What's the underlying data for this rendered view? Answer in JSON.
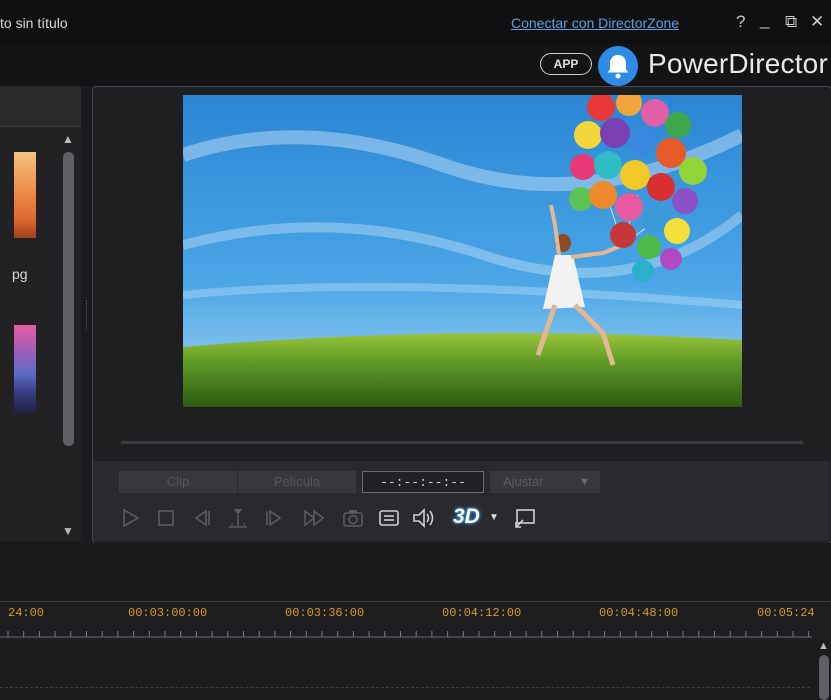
{
  "window": {
    "title": "to sin título",
    "directorzone_link": "Conectar con DirectorZone",
    "help": "?",
    "minimize": "_",
    "restore": "⧉",
    "close": "✕"
  },
  "header": {
    "app_badge": "APP",
    "brand": "PowerDirector",
    "bell_color": "#2e8ce6"
  },
  "library": {
    "item_label": "pg"
  },
  "preview": {
    "tabs": [
      "Clip",
      "Película"
    ],
    "timecode": "--:--:--:--",
    "fit_label": "Ajustar",
    "fit_caret": "▼",
    "three_d_label": "3D",
    "three_d_arrow": "▼",
    "controls": [
      "play-icon",
      "stop-icon",
      "prev-frame-icon",
      "split-icon",
      "next-frame-icon",
      "fast-forward-icon",
      "snapshot-icon",
      "subtitle-icon",
      "volume-icon",
      "undock-icon"
    ]
  },
  "timeline": {
    "ruler_labels": [
      "24:00",
      "00:03:00:00",
      "00:03:36:00",
      "00:04:12:00",
      "00:04:48:00",
      "00:05:24"
    ],
    "ruler_color": "#d69a26"
  }
}
